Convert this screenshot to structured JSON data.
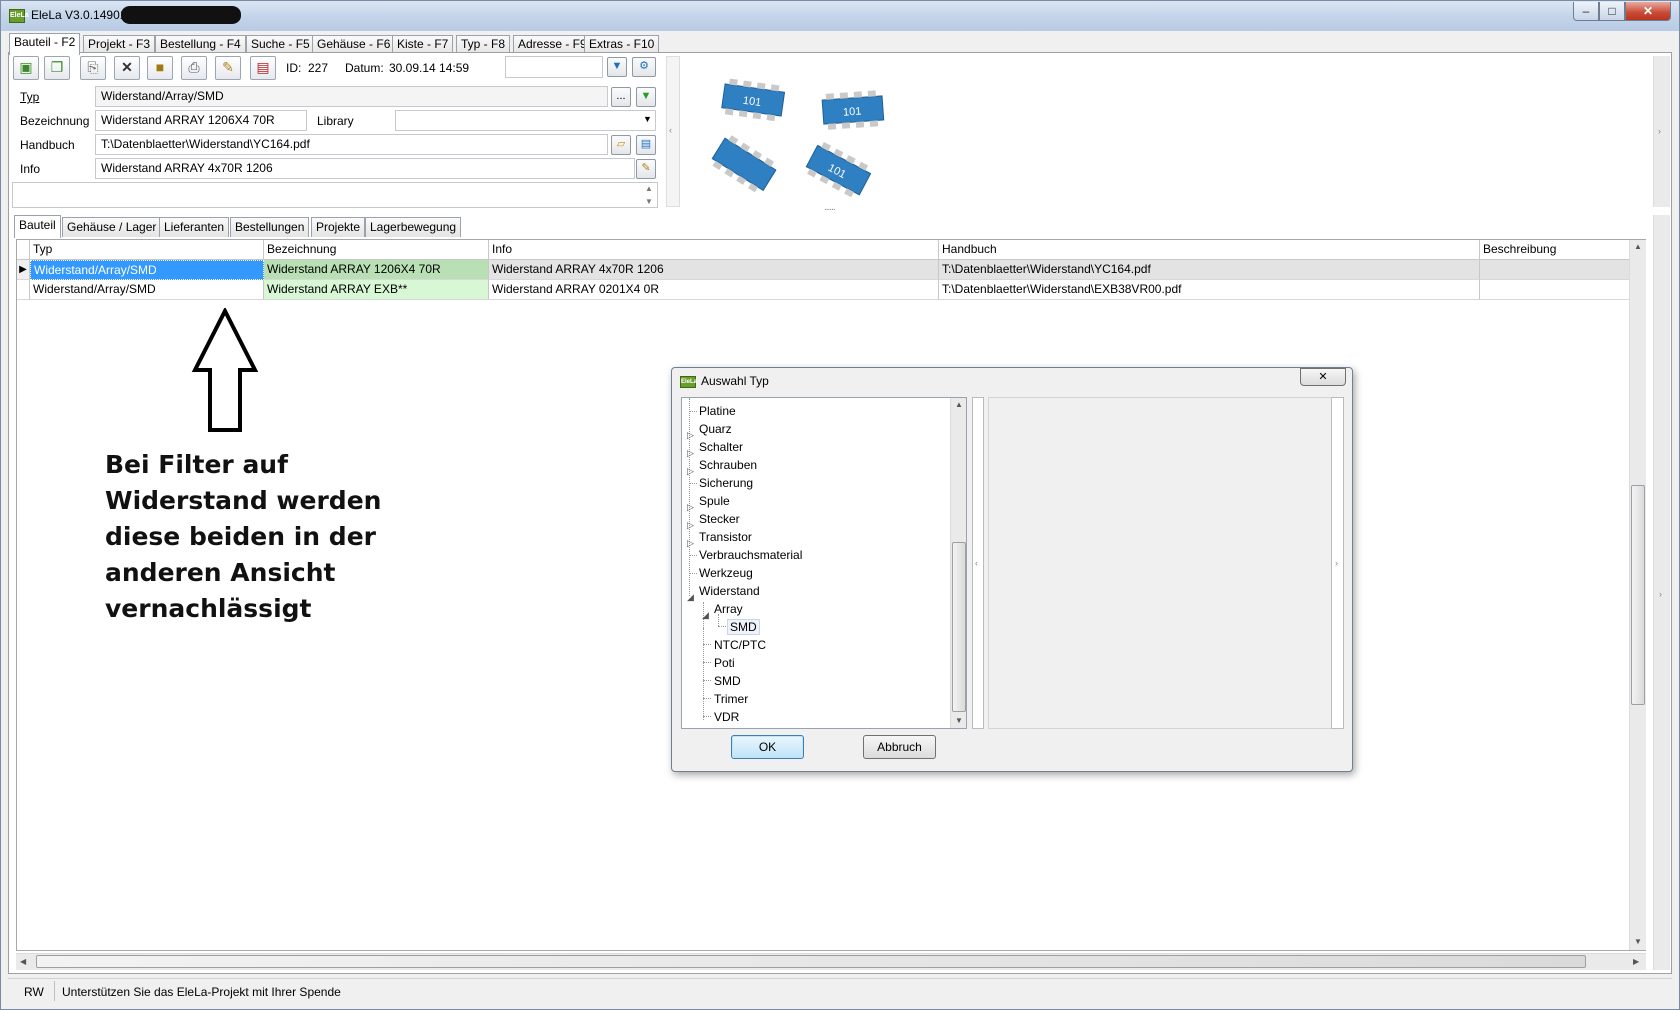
{
  "window": {
    "title": "EleLa V3.0.14901  -",
    "min": "–",
    "max": "□",
    "close": "✕",
    "app_icon": "EleLa"
  },
  "main_tabs": [
    {
      "label": "Bauteil - F2"
    },
    {
      "label": "Projekt - F3"
    },
    {
      "label": "Bestellung - F4"
    },
    {
      "label": "Suche - F5"
    },
    {
      "label": "Gehäuse - F6"
    },
    {
      "label": "Kiste - F7"
    },
    {
      "label": "Typ - F8"
    },
    {
      "label": "Adresse - F9"
    },
    {
      "label": "Extras - F10"
    }
  ],
  "toolbar": {
    "icons": [
      "new-icon",
      "copy-icon",
      "duplicate-icon",
      "delete-icon",
      "box-icon",
      "print-icon",
      "edit-icon",
      "pdf-icon"
    ],
    "id_label": "ID:",
    "id_value": "227",
    "date_label": "Datum:",
    "date_value": "30.09.14 14:59",
    "filter_value": ""
  },
  "form": {
    "typ_label": "Typ",
    "typ_value": "Widerstand/Array/SMD",
    "typ_browse": "...",
    "bez_label": "Bezeichnung",
    "bez_value": "Widerstand ARRAY 1206X4 70R",
    "library_label": "Library",
    "library_value": "",
    "handbuch_label": "Handbuch",
    "handbuch_value": "T:\\Datenblaetter\\Widerstand\\YC164.pdf",
    "info_label": "Info",
    "info_value": "Widerstand ARRAY 4x70R 1206"
  },
  "image": {
    "chip_label": "101",
    "splitter": "......"
  },
  "sub_tabs": [
    {
      "label": "Bauteil"
    },
    {
      "label": "Gehäuse / Lager"
    },
    {
      "label": "Lieferanten"
    },
    {
      "label": "Bestellungen"
    },
    {
      "label": "Projekte"
    },
    {
      "label": "Lagerbewegung"
    }
  ],
  "grid": {
    "columns": [
      "Typ",
      "Bezeichnung",
      "Info",
      "Handbuch",
      "Beschreibung"
    ],
    "rows": [
      {
        "typ": "Widerstand/Array/SMD",
        "bezeichnung": "Widerstand ARRAY 1206X4 70R",
        "info": "Widerstand ARRAY 4x70R 1206",
        "handbuch": "T:\\Datenblaetter\\Widerstand\\YC164.pdf",
        "beschreibung": ""
      },
      {
        "typ": "Widerstand/Array/SMD",
        "bezeichnung": "Widerstand ARRAY EXB**",
        "info": "Widerstand ARRAY 0201X4 0R",
        "handbuch": "T:\\Datenblaetter\\Widerstand\\EXB38VR00.pdf",
        "beschreibung": ""
      }
    ]
  },
  "annotation": {
    "text": "Bei Filter auf Widerstand werden diese beiden in der anderen Ansicht vernachlässigt"
  },
  "dialog": {
    "title": "Auswahl Typ",
    "icon": "EleLa",
    "close": "✕",
    "tree": [
      "Platine",
      "Quarz",
      "Schalter",
      "Schrauben",
      "Sicherung",
      "Spule",
      "Stecker",
      "Transistor",
      "Verbrauchsmaterial",
      "Werkzeug",
      "Widerstand",
      "Array",
      "SMD",
      "NTC/PTC",
      "Poti",
      "SMD",
      "Trimer",
      "VDR"
    ],
    "ok": "OK",
    "cancel": "Abbruch"
  },
  "status": {
    "mode": "RW",
    "message": "Unterstützen Sie das EleLa-Projekt mit Ihrer Spende"
  }
}
